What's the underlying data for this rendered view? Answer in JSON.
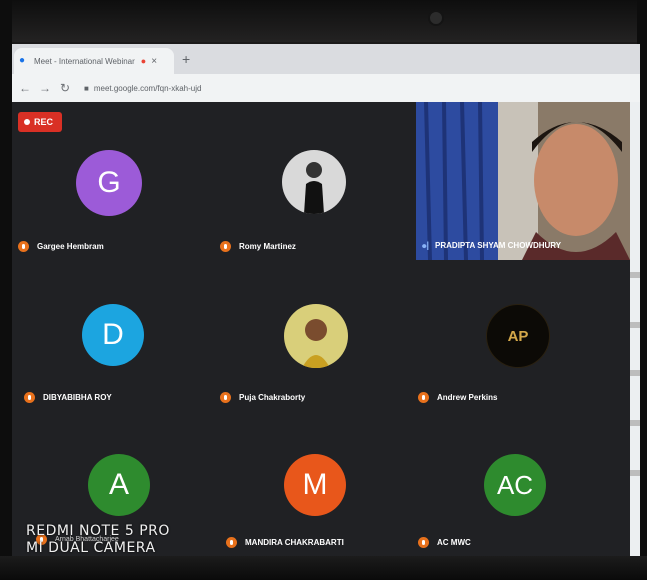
{
  "browser": {
    "tab_title": "Meet - International Webinar",
    "new_tab": "+",
    "url": "meet.google.com/fqn-xkah-ujd"
  },
  "meet": {
    "rec_label": "REC",
    "participants": [
      {
        "name": "Gargee Hembram",
        "initial": "G",
        "color": "#9c5bd8",
        "kind": "letter"
      },
      {
        "name": "Romy Martinez",
        "kind": "photo"
      },
      {
        "name": "PRADIPTA SHYAM CHOWDHURY",
        "kind": "video"
      },
      {
        "name": "DIBYABIBHA ROY",
        "initial": "D",
        "color": "#1ca5e0",
        "kind": "letter"
      },
      {
        "name": "Puja Chakraborty",
        "kind": "photo"
      },
      {
        "name": "Andrew Perkins",
        "initial": "AP",
        "kind": "logo"
      },
      {
        "name": "Arnab Bhattacharjee",
        "initial": "A",
        "color": "#2e8b2e",
        "kind": "letter"
      },
      {
        "name": "MANDIRA CHAKRABARTI",
        "initial": "M",
        "color": "#e8571b",
        "kind": "letter"
      },
      {
        "name": "AC MWC",
        "initial": "AC",
        "color": "#2e8b2e",
        "kind": "letter"
      }
    ]
  },
  "watermark": {
    "line1": "REDMI NOTE 5 PRO",
    "line2": "MI DUAL CAMERA"
  }
}
